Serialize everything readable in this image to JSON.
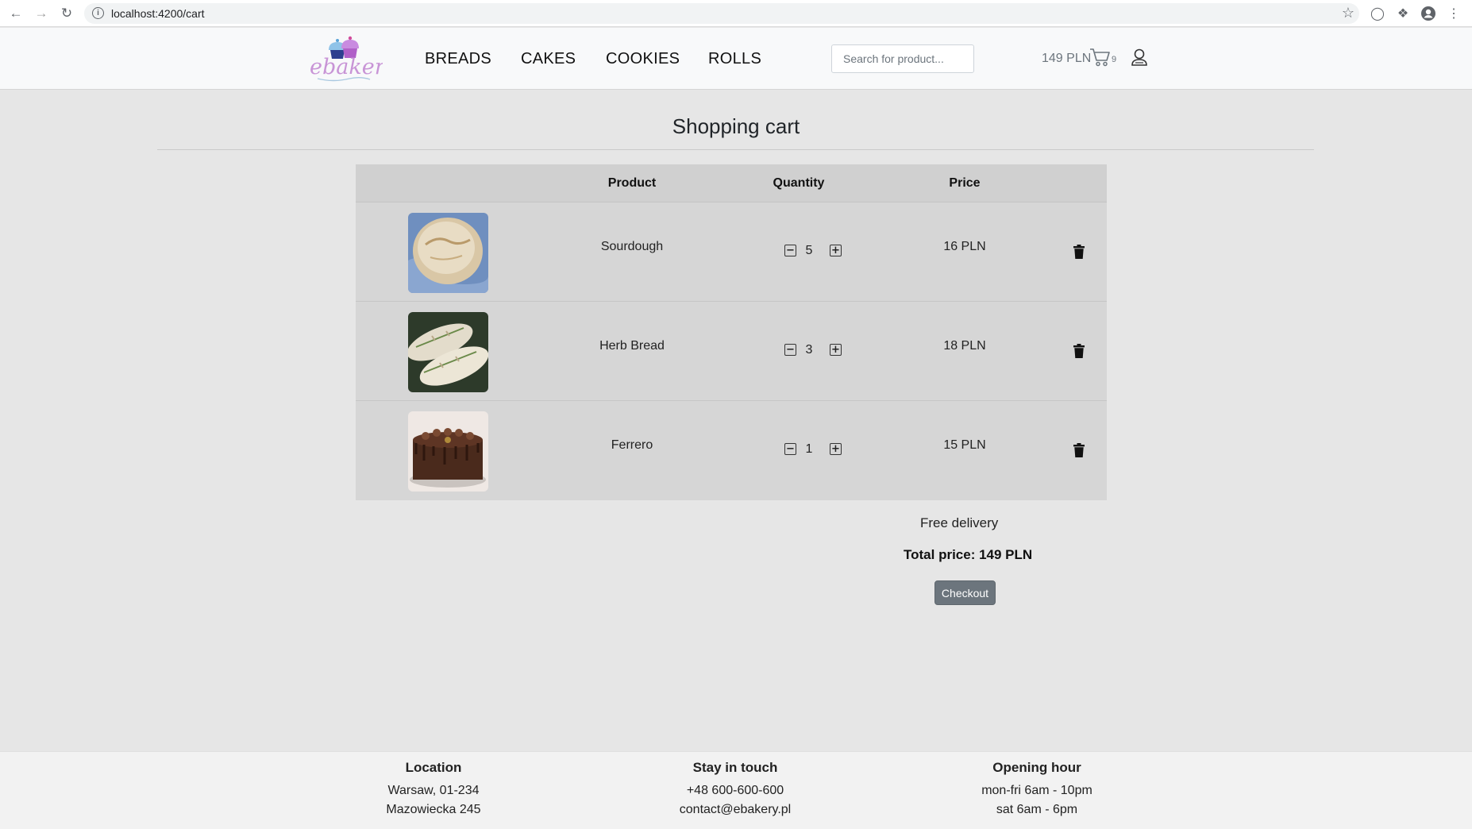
{
  "browser": {
    "url": "localhost:4200/cart"
  },
  "header": {
    "logo_text": "ebakery",
    "nav": [
      "BREADS",
      "CAKES",
      "COOKIES",
      "ROLLS"
    ],
    "search_placeholder": "Search for product...",
    "cart_total": "149 PLN",
    "cart_count": "9"
  },
  "cart": {
    "title": "Shopping cart",
    "columns": {
      "product": "Product",
      "quantity": "Quantity",
      "price": "Price"
    },
    "items": [
      {
        "name": "Sourdough",
        "quantity": "5",
        "price": "16 PLN"
      },
      {
        "name": "Herb Bread",
        "quantity": "3",
        "price": "18 PLN"
      },
      {
        "name": "Ferrero",
        "quantity": "1",
        "price": "15 PLN"
      }
    ],
    "delivery": "Free delivery",
    "total": "Total price: 149 PLN",
    "checkout_label": "Checkout"
  },
  "footer": {
    "location": {
      "title": "Location",
      "line1": "Warsaw, 01-234",
      "line2": "Mazowiecka 245"
    },
    "contact": {
      "title": "Stay in touch",
      "line1": "+48 600-600-600",
      "line2": "contact@ebakery.pl"
    },
    "hours": {
      "title": "Opening hour",
      "line1": "mon-fri 6am - 10pm",
      "line2": "sat 6am - 6pm"
    }
  },
  "colors": {
    "accent_button": "#6c757d",
    "page_bg": "#e6e6e6",
    "table_bg": "#d6d6d6"
  }
}
